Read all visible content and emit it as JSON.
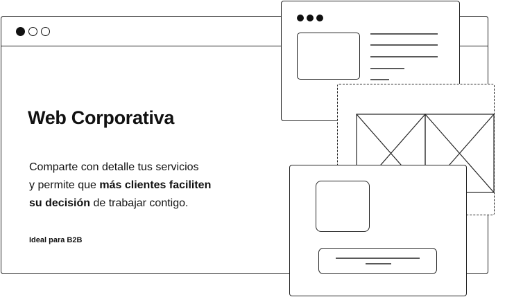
{
  "hero": {
    "title": "Web Corporativa",
    "description": {
      "line1": "Comparte con detalle tus servicios",
      "line2_plain": "y permite que ",
      "line2_bold": "más clientes faciliten",
      "line3_bold": "su decisión",
      "line3_plain": " de trabajar contigo."
    },
    "tag": "Ideal para B2B"
  },
  "icons": {
    "window_controls": [
      "dot-filled-icon",
      "dot-outline-icon",
      "dot-outline-icon"
    ],
    "image_placeholder": "crossed-image-placeholder-icon"
  },
  "colors": {
    "ink": "#111111",
    "background": "#ffffff"
  }
}
